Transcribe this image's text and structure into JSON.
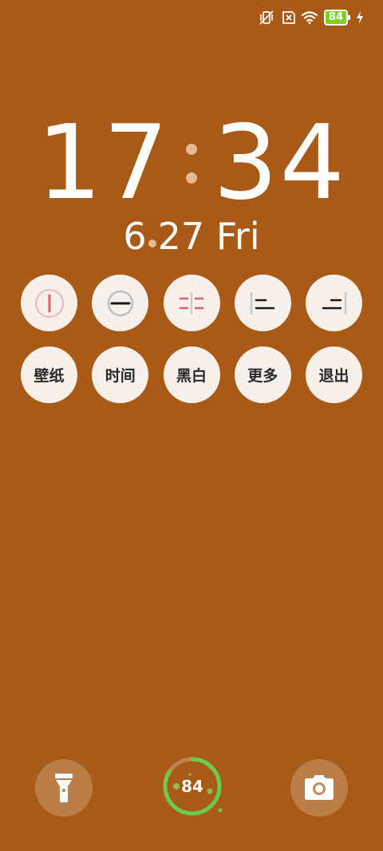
{
  "status_bar": {
    "icons": [
      "vibrate-off-icon",
      "no-sim-icon",
      "wifi-icon",
      "battery-icon",
      "charging-bolt-icon"
    ],
    "battery_level": "84"
  },
  "lockscreen": {
    "hour": "17",
    "minute": "34",
    "date_month_day": [
      "6",
      "27"
    ],
    "weekday": "Fri"
  },
  "style_buttons": [
    {
      "icon": "clock-style-ring-icon"
    },
    {
      "icon": "clock-style-minus-icon"
    },
    {
      "icon": "clock-style-split-icon"
    },
    {
      "icon": "clock-style-left-bar-icon"
    },
    {
      "icon": "clock-style-right-bar-icon"
    }
  ],
  "action_buttons": [
    {
      "label": "壁纸"
    },
    {
      "label": "时间"
    },
    {
      "label": "黑白"
    },
    {
      "label": "更多"
    },
    {
      "label": "退出"
    }
  ],
  "bottom": {
    "flashlight_icon": "flashlight-icon",
    "camera_icon": "camera-icon",
    "battery_ring_value": "84",
    "battery_ring_fraction": 0.84
  },
  "colors": {
    "background": "#A85A16",
    "button_bg": "#F6EFEA",
    "battery_green": "#7ED321",
    "ring_green": "#6BCB4B",
    "accent_pink": "#E35C72"
  }
}
